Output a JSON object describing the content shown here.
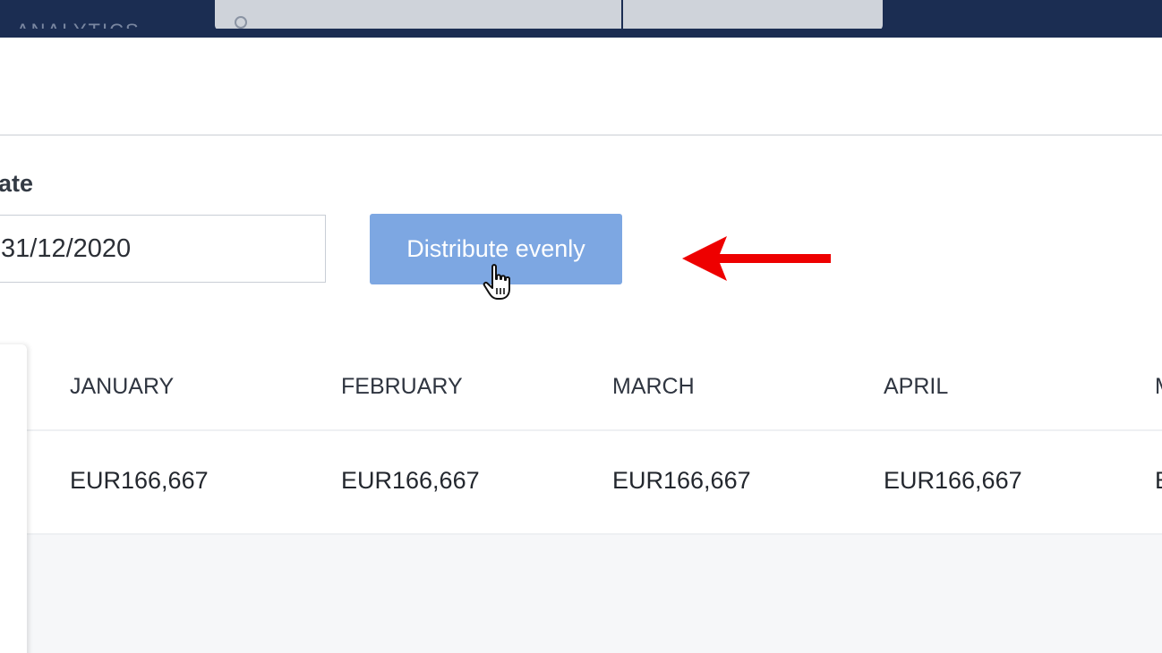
{
  "topnav": {
    "brand_fragment": "ANALYTICS"
  },
  "form": {
    "date_label": "ate",
    "date_value": "31/12/2020",
    "distribute_button": "Distribute evenly"
  },
  "colors": {
    "nav": "#1b2d52",
    "button": "#7da7e2",
    "annotation_arrow": "#ee0000"
  },
  "table": {
    "columns": [
      "JANUARY",
      "FEBRUARY",
      "MARCH",
      "APRIL",
      "M"
    ],
    "row": [
      "EUR166,667",
      "EUR166,667",
      "EUR166,667",
      "EUR166,667",
      "E"
    ]
  }
}
